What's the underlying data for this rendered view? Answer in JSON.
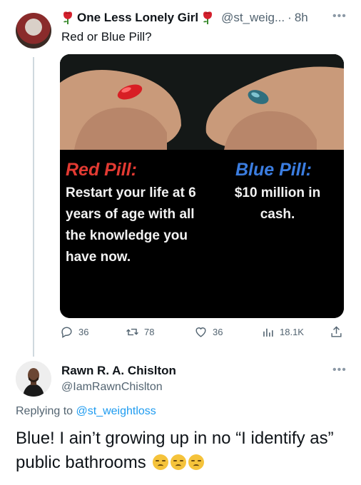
{
  "tweet": {
    "author_name": "One Less Lonely Girl",
    "handle": "@st_weig...",
    "separator": "·",
    "time": "8h",
    "text": "Red or Blue Pill?",
    "media": {
      "red_heading": "Red Pill:",
      "red_body": "Restart your life at 6 years of age with all the knowledge you have now.",
      "blue_heading": "Blue Pill:",
      "blue_body": "$10 million in cash."
    },
    "actions": {
      "reply_count": "36",
      "retweet_count": "78",
      "like_count": "36",
      "views_count": "18.1K"
    }
  },
  "reply": {
    "author_name": "Rawn R. A. Chislton",
    "handle": "@IamRawnChislton",
    "replying_prefix": "Replying to",
    "replying_to": "@st_weightloss",
    "text": "Blue! I ain’t growing up in no “I identify as” public bathrooms"
  },
  "colors": {
    "link": "#1d9bf0",
    "muted": "#536471",
    "red_pill": "#e23a32",
    "blue_pill": "#3b7de0"
  },
  "icons": [
    "rose-emoji",
    "more-icon",
    "reply-icon",
    "retweet-icon",
    "like-icon",
    "views-icon",
    "share-icon",
    "unamused-emoji"
  ]
}
